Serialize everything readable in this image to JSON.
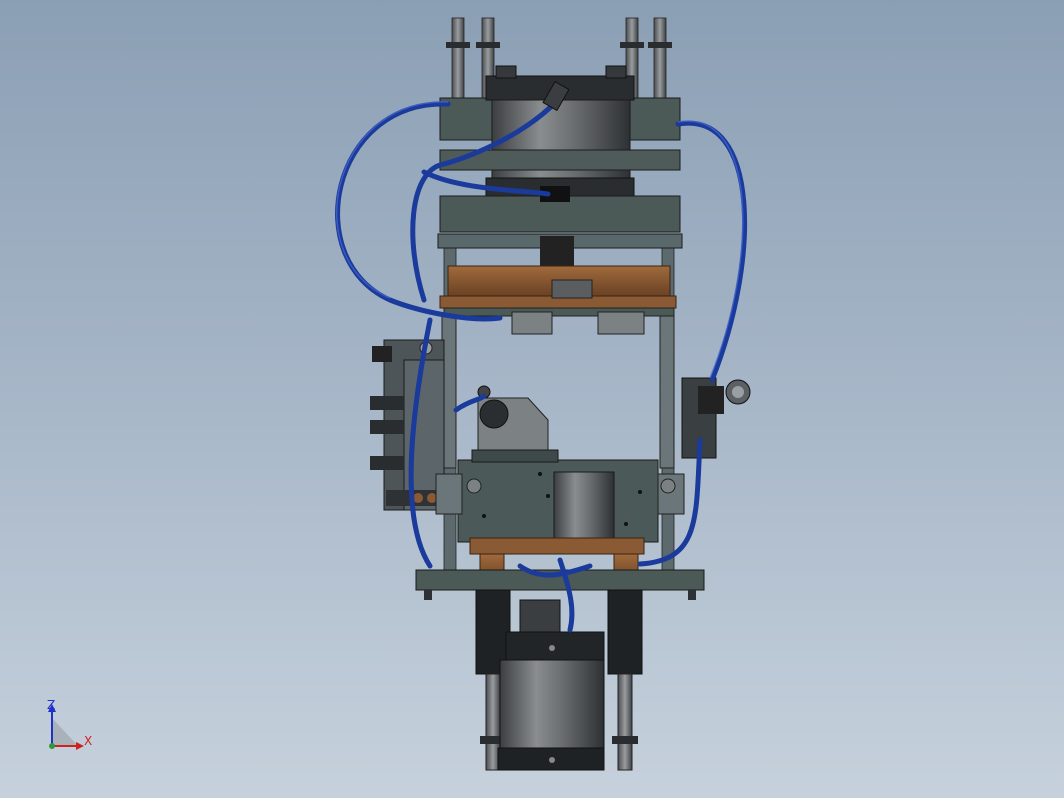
{
  "view": {
    "background_top": "#8b9fb4",
    "background_bottom": "#c6d1dc",
    "hose_color": "#1a3a9c",
    "frame_color": "#5c6a6e",
    "plate_color": "#4b5957",
    "wood_color": "#8a5a34",
    "cylinder_color": "#6b6e70"
  },
  "triad": {
    "z_label": "Z",
    "x_label": "X",
    "z_color": "#2030c8",
    "x_color": "#d02020"
  }
}
